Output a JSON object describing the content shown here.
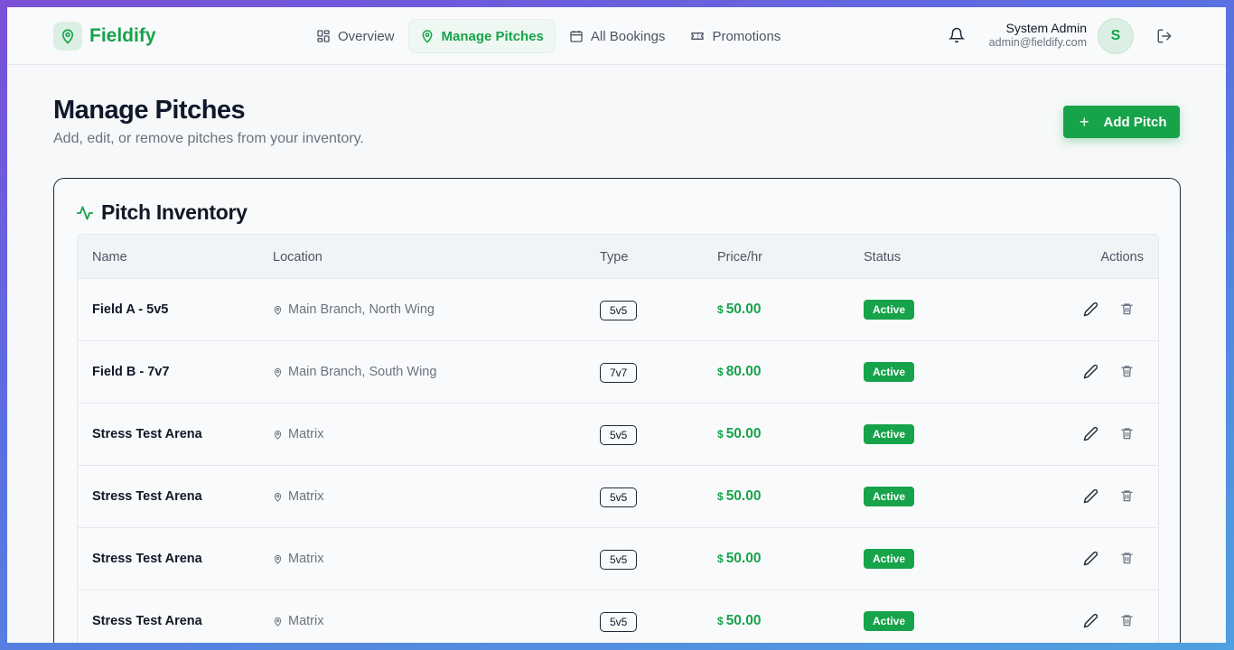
{
  "app": {
    "name": "Fieldify",
    "brand_color": "#16a34a"
  },
  "nav": [
    {
      "label": "Overview",
      "icon": "grid-icon",
      "active": false
    },
    {
      "label": "Manage Pitches",
      "icon": "map-pin-icon",
      "active": true
    },
    {
      "label": "All Bookings",
      "icon": "calendar-icon",
      "active": false
    },
    {
      "label": "Promotions",
      "icon": "ticket-icon",
      "active": false
    }
  ],
  "user": {
    "name": "System Admin",
    "email": "admin@fieldify.com",
    "initial": "S"
  },
  "page": {
    "title": "Manage Pitches",
    "subtitle": "Add, edit, or remove pitches from your inventory.",
    "add_button": "Add Pitch"
  },
  "card": {
    "title": "Pitch Inventory"
  },
  "table": {
    "columns": [
      "Name",
      "Location",
      "Type",
      "Price/hr",
      "Status",
      "Actions"
    ],
    "rows": [
      {
        "name": "Field A - 5v5",
        "location": "Main Branch, North Wing",
        "type": "5v5",
        "currency": "$",
        "price": "50.00",
        "status": "Active"
      },
      {
        "name": "Field B - 7v7",
        "location": "Main Branch, South Wing",
        "type": "7v7",
        "currency": "$",
        "price": "80.00",
        "status": "Active"
      },
      {
        "name": "Stress Test Arena",
        "location": "Matrix",
        "type": "5v5",
        "currency": "$",
        "price": "50.00",
        "status": "Active"
      },
      {
        "name": "Stress Test Arena",
        "location": "Matrix",
        "type": "5v5",
        "currency": "$",
        "price": "50.00",
        "status": "Active"
      },
      {
        "name": "Stress Test Arena",
        "location": "Matrix",
        "type": "5v5",
        "currency": "$",
        "price": "50.00",
        "status": "Active"
      },
      {
        "name": "Stress Test Arena",
        "location": "Matrix",
        "type": "5v5",
        "currency": "$",
        "price": "50.00",
        "status": "Active"
      }
    ]
  }
}
